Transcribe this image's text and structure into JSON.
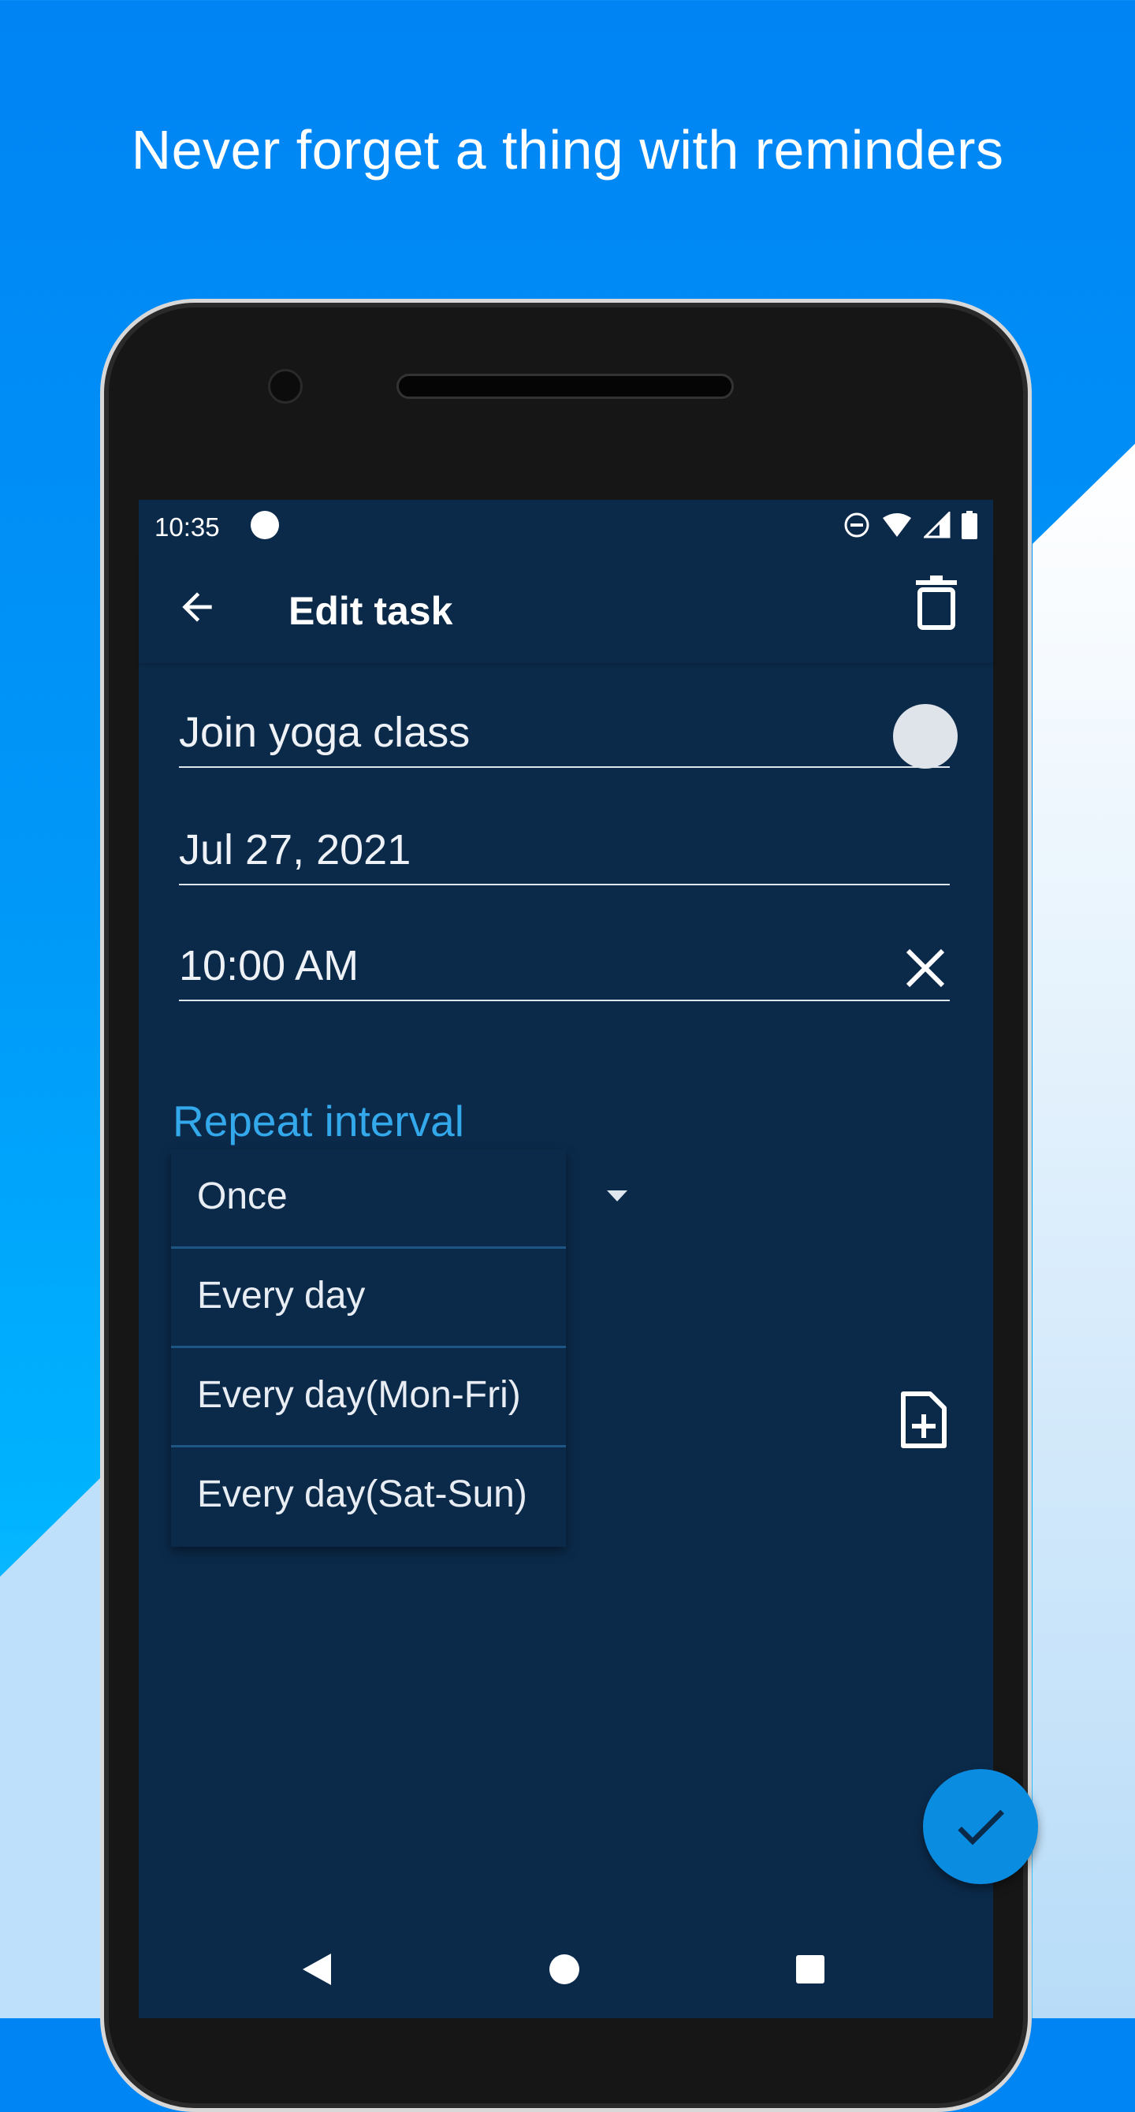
{
  "headline": "Never forget a thing with reminders",
  "colors": {
    "background": "#0088f0",
    "screen": "#0b2a4a",
    "accent": "#33a9ec",
    "fab": "#0a8ce0"
  },
  "status_bar": {
    "time": "10:35",
    "icons": [
      "app-notification-icon",
      "do-not-disturb-icon",
      "wifi-icon",
      "signal-icon",
      "battery-icon"
    ]
  },
  "toolbar": {
    "title": "Edit task",
    "back_icon": "arrow-left-icon",
    "delete_icon": "trash-icon"
  },
  "form": {
    "task_name": "Join yoga class",
    "date": "Jul 27, 2021",
    "time": "10:00 AM",
    "repeat_label": "Repeat interval",
    "repeat_options": [
      "Once",
      "Every day",
      "Every day(Mon-Fri)",
      "Every day(Sat-Sun)"
    ],
    "repeat_selected": "Once"
  },
  "nav": [
    "back",
    "home",
    "recents"
  ]
}
